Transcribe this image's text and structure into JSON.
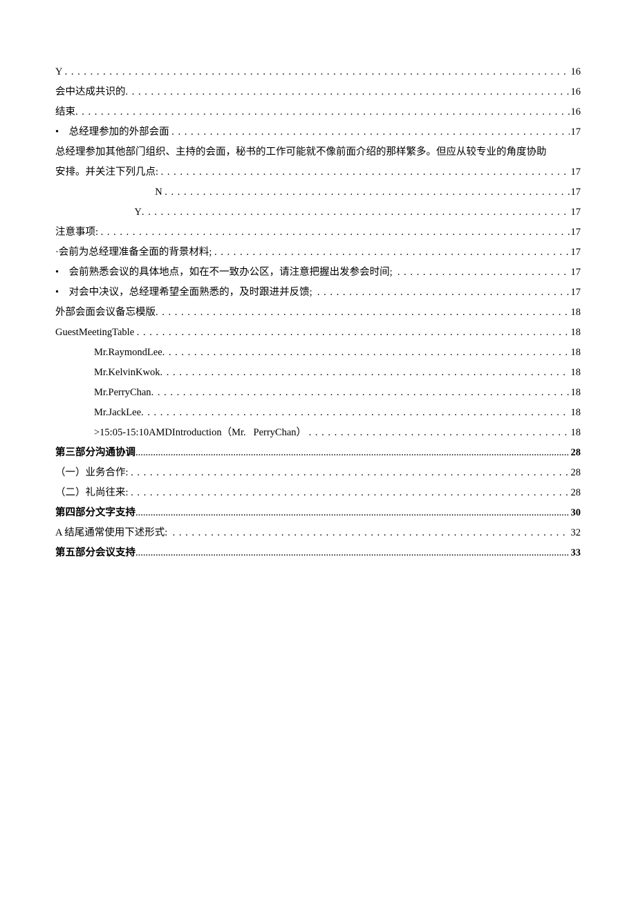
{
  "toc": [
    {
      "label": "Y ",
      "page": " 16",
      "indent": 0,
      "dense": false
    },
    {
      "label": "会中达成共识的",
      "page": " 16",
      "indent": 0,
      "dense": false
    },
    {
      "label": "结束",
      "page": " 16",
      "indent": 0,
      "dense": false
    },
    {
      "label": "•    总经理参加的外部会面 ",
      "page": " 17",
      "indent": 0,
      "dense": false
    },
    {
      "label": "总经理参加其他部门组织、主持的会面，秘书的工作可能就不像前面介绍的那样繁多。但应从较专业的角度协助安排。并关注下列几点: ",
      "page": " 17",
      "indent": 0,
      "dense": false,
      "multiline": true
    },
    {
      "label": "N ",
      "page": " 17",
      "indent": 0,
      "dense": false,
      "pad": 400
    },
    {
      "label": "Y",
      "page": " 17",
      "indent": 0,
      "dense": false,
      "pad": 300
    },
    {
      "label": "注意事项: ",
      "page": " 17",
      "indent": 0,
      "dense": false
    },
    {
      "label": "·会前为总经理准备全面的背景材料; ",
      "page": " 17",
      "indent": 0,
      "dense": false
    },
    {
      "label": "•    会前熟悉会议的具体地点，如在不一致办公区，请注意把握出发参会时间;  ",
      "page": " 17",
      "indent": 0,
      "dense": false
    },
    {
      "label": "•    对会中决议，总经理希望全面熟悉的，及时跟进并反馈;  ",
      "page": " 17",
      "indent": 0,
      "dense": false
    },
    {
      "label": "外部会面会议备忘模版",
      "page": " 18",
      "indent": 0,
      "dense": false
    },
    {
      "label": "GuestMeetingTable ",
      "page": " 18",
      "indent": 0,
      "dense": false
    },
    {
      "label": "Mr.RaymondLee",
      "page": " 18",
      "indent": 1,
      "dense": false
    },
    {
      "label": "Mr.KelvinKwok",
      "page": " 18",
      "indent": 1,
      "dense": false
    },
    {
      "label": "Mr.PerryChan",
      "page": " 18",
      "indent": 1,
      "dense": false
    },
    {
      "label": "Mr.JackLee",
      "page": " 18",
      "indent": 1,
      "dense": false
    },
    {
      "label": ">15:05-15:10AMDIntroduction（Mr.   PerryChan） ",
      "page": " 18",
      "indent": 1,
      "dense": false
    },
    {
      "label": "第三部分沟通协调",
      "page": "28",
      "indent": 0,
      "dense": true,
      "bold": true
    },
    {
      "label": "（一）业务合作: ",
      "page": " 28",
      "indent": 0,
      "dense": false
    },
    {
      "label": "（二）礼尚往来: ",
      "page": " 28",
      "indent": 0,
      "dense": false
    },
    {
      "label": "第四部分文字支持",
      "page": "30",
      "indent": 0,
      "dense": true,
      "bold": true
    },
    {
      "label": "A 结尾通常使用下述形式:  ",
      "page": " 32",
      "indent": 0,
      "dense": false
    },
    {
      "label": "第五部分会议支持",
      "page": "33",
      "indent": 0,
      "dense": true,
      "bold": true
    }
  ]
}
